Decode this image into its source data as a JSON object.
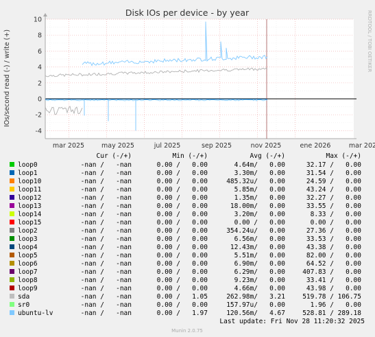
{
  "chart_data": {
    "type": "line",
    "title": "Disk IOs per device - by year",
    "ylabel": "IOs/second read (-) / write (+)",
    "side_label": "RRDTOOL / TOBI OETIKER",
    "ylim": [
      -5,
      10
    ],
    "y_ticks": [
      "-4",
      "-2",
      "0",
      "2",
      "4",
      "6",
      "8",
      "10"
    ],
    "x_ticks": [
      "mar 2025",
      "may 2025",
      "jul 2025",
      "sep 2025",
      "nov 2025",
      "ene 2026",
      "mar 2026"
    ],
    "grid": true,
    "columns": [
      "Cur (-/+)",
      "Min (-/+)",
      "Avg (-/+)",
      "Max (-/+)"
    ],
    "series": [
      {
        "name": "loop0",
        "color": "#00cc00",
        "cur": "-nan /   -nan",
        "min": "0.00 /   0.00",
        "avg": "4.64m/   0.00",
        "max": "32.17 /   0.00"
      },
      {
        "name": "loop1",
        "color": "#0066b3",
        "cur": "-nan /   -nan",
        "min": "0.00 /   0.00",
        "avg": "3.30m/   0.00",
        "max": "31.54 /   0.00"
      },
      {
        "name": "loop10",
        "color": "#ff8000",
        "cur": "-nan /   -nan",
        "min": "0.00 /   0.00",
        "avg": "485.32u/   0.00",
        "max": "24.59 /   0.00"
      },
      {
        "name": "loop11",
        "color": "#ffcc00",
        "cur": "-nan /   -nan",
        "min": "0.00 /   0.00",
        "avg": "5.85m/   0.00",
        "max": "43.24 /   0.00"
      },
      {
        "name": "loop12",
        "color": "#330099",
        "cur": "-nan /   -nan",
        "min": "0.00 /   0.00",
        "avg": "1.35m/   0.00",
        "max": "32.27 /   0.00"
      },
      {
        "name": "loop13",
        "color": "#990099",
        "cur": "-nan /   -nan",
        "min": "0.00 /   0.00",
        "avg": "18.00m/   0.00",
        "max": "33.55 /   0.00"
      },
      {
        "name": "loop14",
        "color": "#ccff00",
        "cur": "-nan /   -nan",
        "min": "0.00 /   0.00",
        "avg": "3.20m/   0.00",
        "max": "8.33 /   0.00"
      },
      {
        "name": "loop15",
        "color": "#ff0000",
        "cur": "-nan /   -nan",
        "min": "0.00 /   0.00",
        "avg": "0.00 /   0.00",
        "max": "0.00 /   0.00"
      },
      {
        "name": "loop2",
        "color": "#808080",
        "cur": "-nan /   -nan",
        "min": "0.00 /   0.00",
        "avg": "354.24u/   0.00",
        "max": "27.36 /   0.00"
      },
      {
        "name": "loop3",
        "color": "#008f00",
        "cur": "-nan /   -nan",
        "min": "0.00 /   0.00",
        "avg": "6.56m/   0.00",
        "max": "33.53 /   0.00"
      },
      {
        "name": "loop4",
        "color": "#00487d",
        "cur": "-nan /   -nan",
        "min": "0.00 /   0.00",
        "avg": "12.43m/   0.00",
        "max": "43.38 /   0.00"
      },
      {
        "name": "loop5",
        "color": "#b35a00",
        "cur": "-nan /   -nan",
        "min": "0.00 /   0.00",
        "avg": "5.51m/   0.00",
        "max": "82.00 /   0.00"
      },
      {
        "name": "loop6",
        "color": "#b38f00",
        "cur": "-nan /   -nan",
        "min": "0.00 /   0.00",
        "avg": "6.90m/   0.00",
        "max": "64.52 /   0.00"
      },
      {
        "name": "loop7",
        "color": "#6b006b",
        "cur": "-nan /   -nan",
        "min": "0.00 /   0.00",
        "avg": "6.29m/   0.00",
        "max": "407.83 /   0.00"
      },
      {
        "name": "loop8",
        "color": "#8fb300",
        "cur": "-nan /   -nan",
        "min": "0.00 /   0.00",
        "avg": "9.23m/   0.00",
        "max": "33.41 /   0.00"
      },
      {
        "name": "loop9",
        "color": "#b30000",
        "cur": "-nan /   -nan",
        "min": "0.00 /   0.00",
        "avg": "4.66m/   0.00",
        "max": "43.98 /   0.00"
      },
      {
        "name": "sda",
        "color": "#bebebe",
        "cur": "-nan /   -nan",
        "min": "0.00 /   1.05",
        "avg": "262.98m/   3.21",
        "max": "519.78 / 106.75"
      },
      {
        "name": "sr0",
        "color": "#80ff80",
        "cur": "-nan /   -nan",
        "min": "0.00 /   0.00",
        "avg": "157.97u/   0.00",
        "max": "1.96 /   0.00"
      },
      {
        "name": "ubuntu-lv",
        "color": "#80c9ff",
        "cur": "-nan /   -nan",
        "min": "0.00 /   1.97",
        "avg": "120.56m/   4.67",
        "max": "528.81 / 289.18"
      }
    ],
    "last_update": "Last update: Fri Nov 28 11:20:32 2025",
    "footer": "Munin 2.0.75"
  }
}
